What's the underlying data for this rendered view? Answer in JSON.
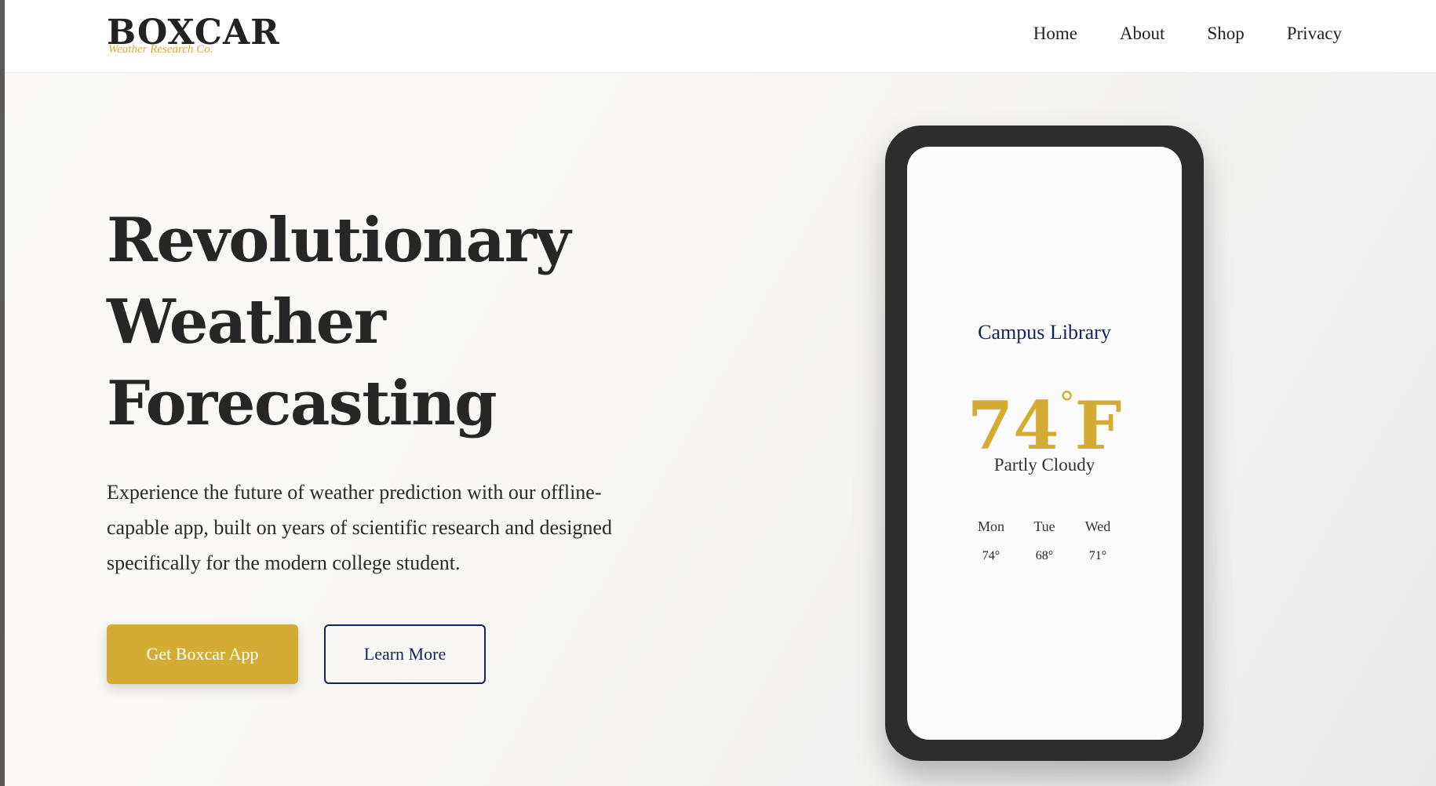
{
  "header": {
    "logo": "BOXCAR",
    "tagline": "Weather Research Co.",
    "nav": [
      "Home",
      "About",
      "Shop",
      "Privacy"
    ]
  },
  "hero": {
    "title_lines": [
      "Revolutionary",
      "Weather",
      "Forecasting"
    ],
    "description": "Experience the future of weather prediction with our offline-capable app, built on years of scientific research and designed specifically for the modern college student.",
    "primary_button": "Get Boxcar App",
    "secondary_button": "Learn More"
  },
  "phone": {
    "location": "Campus Library",
    "temperature": "74",
    "degree_symbol": "°",
    "unit": "F",
    "condition": "Partly Cloudy",
    "forecast": [
      {
        "day": "Mon",
        "temp": "74°"
      },
      {
        "day": "Tue",
        "temp": "68°"
      },
      {
        "day": "Wed",
        "temp": "71°"
      }
    ]
  },
  "colors": {
    "accent": "#d4ac33",
    "navy": "#14235a",
    "dark": "#262626"
  }
}
